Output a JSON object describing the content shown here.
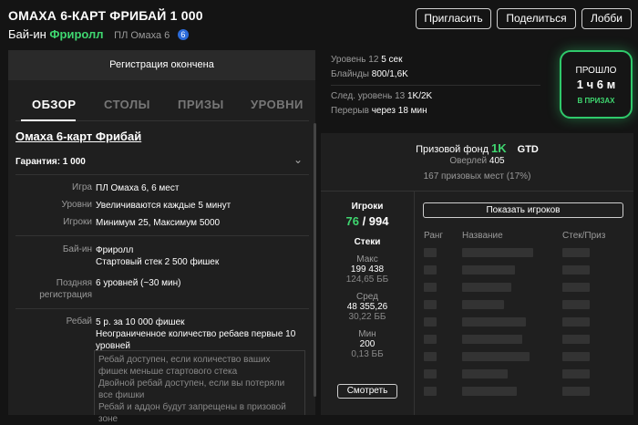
{
  "header": {
    "title": "ОМАХА 6-КАРТ ФРИБАЙ 1 000",
    "buyin_label": "Бай-ин",
    "buyin_value": "Фриролл",
    "pool_type": "ПЛ Омаха 6",
    "badge": "6",
    "buttons": {
      "invite": "Пригласить",
      "share": "Поделиться",
      "lobby": "Лобби"
    }
  },
  "registration_status": "Регистрация окончена",
  "tabs": [
    "ОБЗОР",
    "СТОЛЫ",
    "ПРИЗЫ",
    "УРОВНИ"
  ],
  "overview": {
    "name": "Омаха 6-карт Фрибай",
    "guarantee": "Гарантия: 1 000",
    "rows": [
      {
        "label": "Игра",
        "value": "ПЛ Омаха 6, 6 мест"
      },
      {
        "label": "Уровни",
        "value": "Увеличиваются каждые 5 минут"
      },
      {
        "label": "Игроки",
        "value": "Минимум 25, Максимум 5000"
      },
      {
        "label": "Бай-ин",
        "value": "Фриролл",
        "value2": "Стартовый стек 2 500 фишек"
      },
      {
        "label": "Поздняя регистрация",
        "value": "6 уровней (~30 мин)"
      },
      {
        "label": "Ребай",
        "value": "5 р. за 10 000 фишек",
        "value2": "Неограниченное количество ребаев первые 10 уровней"
      }
    ],
    "note": [
      "Ребай доступен, если количество ваших фишек меньше стартового стека",
      "Двойной ребай доступен, если вы потеряли все фишки",
      "Ребай и аддон будут запрещены в призовой зоне"
    ]
  },
  "level_info": {
    "level_label": "Уровень 12",
    "level_time": "5 сек",
    "blinds_label": "Блайнды",
    "blinds_value": "800/1,6K",
    "next_label": "След. уровень 13",
    "next_value": "1K/2K",
    "break_label": "Перерыв",
    "break_value": "через 18 мин"
  },
  "timer": {
    "label": "ПРОШЛО",
    "value": "1 ч 6 м",
    "status": "В ПРИЗАХ",
    "accent": "#2fc96b"
  },
  "prize": {
    "label": "Призовой фонд",
    "amount": "1K",
    "gtd": "GTD",
    "overlay_label": "Оверлей",
    "overlay_value": "405",
    "places": "167 призовых мест (17%)"
  },
  "players": {
    "title": "Игроки",
    "remaining": "76",
    "total": "/ 994",
    "stacks_title": "Стеки",
    "max_label": "Макс",
    "max_value": "199 438",
    "max_bb": "124,65 ББ",
    "avg_label": "Сред",
    "avg_value": "48 355,26",
    "avg_bb": "30,22 ББ",
    "min_label": "Мин",
    "min_value": "200",
    "min_bb": "0,13 ББ",
    "watch_button": "Смотреть",
    "show_players_button": "Показать игроков",
    "columns": [
      "Ранг",
      "Название",
      "Стек/Приз"
    ]
  }
}
